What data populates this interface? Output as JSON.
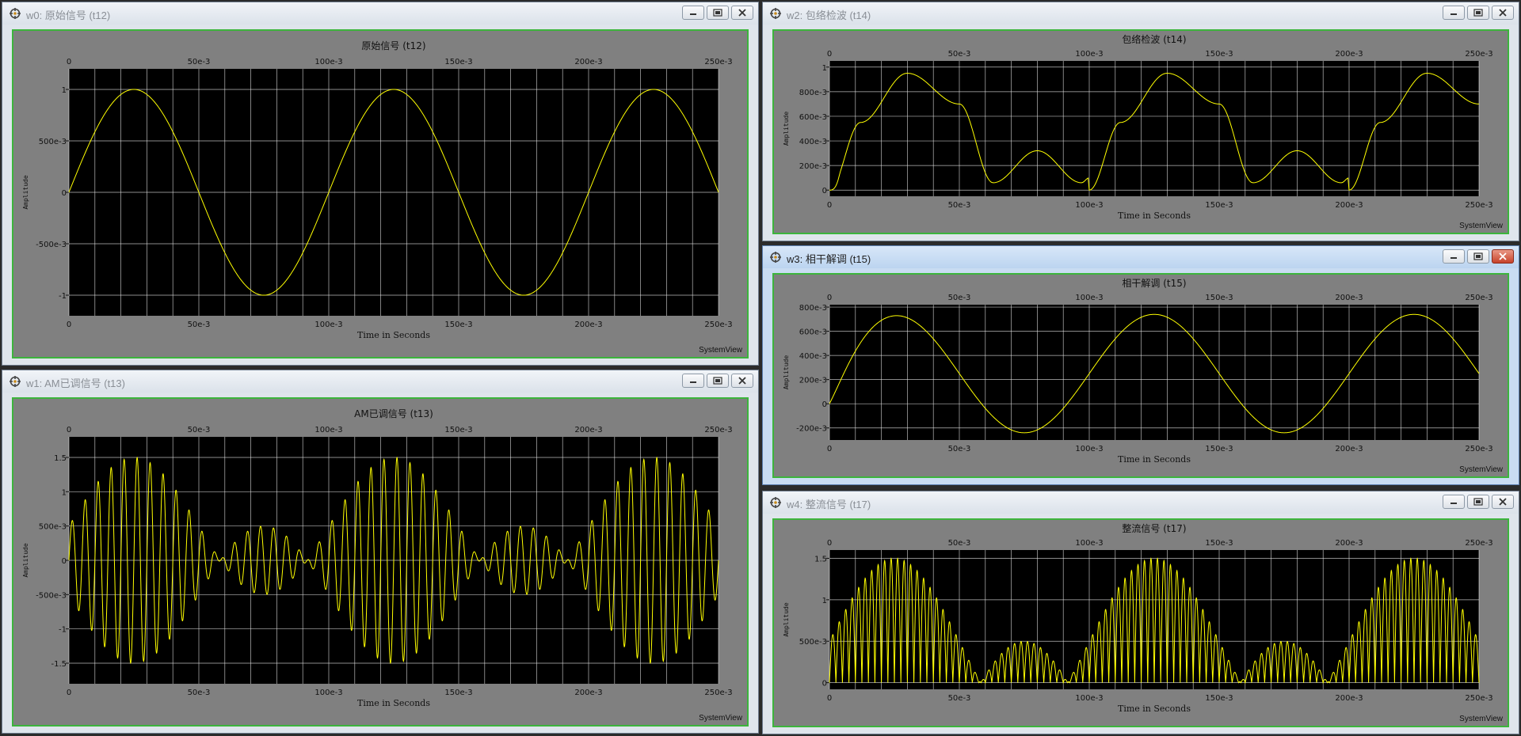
{
  "footer_label": "SystemView",
  "axis": {
    "ylabel": "Amplitude",
    "xlabel": "Time in Seconds"
  },
  "colors": {
    "trace": "#ffff00",
    "plot_bg": "#000000",
    "panel_bg": "#808080",
    "grid": "#e8e8e8",
    "frame": "#3cb43c"
  },
  "windows": [
    {
      "id": "w0",
      "title": "w0: 原始信号 (t12)",
      "active": false,
      "buttons": [
        "minimize",
        "restore",
        "close"
      ],
      "chart_data": {
        "type": "line",
        "title": "原始信号 (t12)",
        "xlabel": "Time in Seconds",
        "ylabel": "Amplitude",
        "xlim": [
          0,
          0.25
        ],
        "ylim": [
          -1.2,
          1.2
        ],
        "xticks": [
          "0",
          "50e-3",
          "100e-3",
          "150e-3",
          "200e-3",
          "250e-3"
        ],
        "yticks": [
          {
            "value": 1,
            "label": "1"
          },
          {
            "value": 0.5,
            "label": "500e-3"
          },
          {
            "value": 0,
            "label": "0"
          },
          {
            "value": -0.5,
            "label": "-500e-3"
          },
          {
            "value": -1,
            "label": "-1"
          }
        ],
        "grid": true,
        "signal": {
          "kind": "sine",
          "amplitude": 1.0,
          "frequency_hz": 10
        }
      }
    },
    {
      "id": "w1",
      "title": "w1: AM已调信号 (t13)",
      "active": false,
      "buttons": [
        "minimize",
        "restore",
        "close"
      ],
      "chart_data": {
        "type": "line",
        "title": "AM已调信号 (t13)",
        "xlabel": "Time in Seconds",
        "ylabel": "Amplitude",
        "xlim": [
          0,
          0.25
        ],
        "ylim": [
          -1.8,
          1.8
        ],
        "xticks": [
          "0",
          "50e-3",
          "100e-3",
          "150e-3",
          "200e-3",
          "250e-3"
        ],
        "yticks": [
          {
            "value": 1.5,
            "label": "1.5"
          },
          {
            "value": 1,
            "label": "1"
          },
          {
            "value": 0.5,
            "label": "500e-3"
          },
          {
            "value": 0,
            "label": "0"
          },
          {
            "value": -0.5,
            "label": "-500e-3"
          },
          {
            "value": -1,
            "label": "-1"
          },
          {
            "value": -1.5,
            "label": "-1.5"
          }
        ],
        "grid": true,
        "signal": {
          "kind": "am",
          "offset": 0.5,
          "message_amplitude": 1.0,
          "message_frequency_hz": 10,
          "carrier_frequency_hz": 200
        }
      }
    },
    {
      "id": "w2",
      "title": "w2: 包络检波 (t14)",
      "active": false,
      "buttons": [
        "minimize",
        "restore",
        "close"
      ],
      "chart_data": {
        "type": "line",
        "title": "包络检波 (t14)",
        "xlabel": "Time in Seconds",
        "ylabel": "Amplitude",
        "xlim": [
          0,
          0.25
        ],
        "ylim": [
          -0.05,
          1.05
        ],
        "xticks": [
          "0",
          "50e-3",
          "100e-3",
          "150e-3",
          "200e-3",
          "250e-3"
        ],
        "yticks": [
          {
            "value": 1,
            "label": "1"
          },
          {
            "value": 0.8,
            "label": "800e-3"
          },
          {
            "value": 0.6,
            "label": "600e-3"
          },
          {
            "value": 0.4,
            "label": "400e-3"
          },
          {
            "value": 0.2,
            "label": "200e-3"
          },
          {
            "value": 0,
            "label": "0"
          }
        ],
        "grid": true,
        "signal": {
          "kind": "envelope",
          "peak": 0.95,
          "valley": 0.06,
          "hump": 0.32
        }
      }
    },
    {
      "id": "w3",
      "title": "w3: 相干解调 (t15)",
      "active": true,
      "buttons": [
        "minimize",
        "restore",
        "close"
      ],
      "chart_data": {
        "type": "line",
        "title": "相干解调 (t15)",
        "xlabel": "Time in Seconds",
        "ylabel": "Amplitude",
        "xlim": [
          0,
          0.25
        ],
        "ylim": [
          -0.3,
          0.82
        ],
        "xticks": [
          "0",
          "50e-3",
          "100e-3",
          "150e-3",
          "200e-3",
          "250e-3"
        ],
        "yticks": [
          {
            "value": 0.8,
            "label": "800e-3"
          },
          {
            "value": 0.6,
            "label": "600e-3"
          },
          {
            "value": 0.4,
            "label": "400e-3"
          },
          {
            "value": 0.2,
            "label": "200e-3"
          },
          {
            "value": 0,
            "label": "0"
          },
          {
            "value": -0.2,
            "label": "-200e-3"
          }
        ],
        "grid": true,
        "signal": {
          "kind": "coherent",
          "offset": 0.25,
          "amplitude": 0.5,
          "frequency_hz": 10,
          "peak": 0.74,
          "trough": -0.24
        }
      }
    },
    {
      "id": "w4",
      "title": "w4: 整流信号 (t17)",
      "active": false,
      "buttons": [
        "minimize",
        "restore",
        "close"
      ],
      "chart_data": {
        "type": "line",
        "title": "整流信号 (t17)",
        "xlabel": "Time in Seconds",
        "ylabel": "Amplitude",
        "xlim": [
          0,
          0.25
        ],
        "ylim": [
          -0.08,
          1.6
        ],
        "xticks": [
          "0",
          "50e-3",
          "100e-3",
          "150e-3",
          "200e-3",
          "250e-3"
        ],
        "yticks": [
          {
            "value": 1.5,
            "label": "1.5"
          },
          {
            "value": 1,
            "label": "1"
          },
          {
            "value": 0.5,
            "label": "500e-3"
          },
          {
            "value": 0,
            "label": "0"
          }
        ],
        "grid": true,
        "signal": {
          "kind": "rectified",
          "offset": 0.5,
          "message_amplitude": 1.0,
          "message_frequency_hz": 10,
          "carrier_frequency_hz": 200
        }
      }
    }
  ]
}
